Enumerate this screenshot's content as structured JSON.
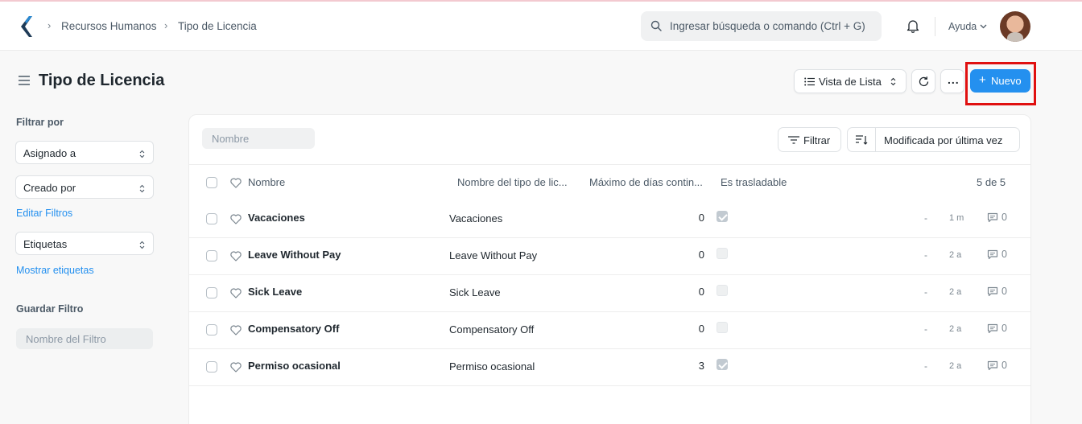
{
  "breadcrumb": [
    "Recursos Humanos",
    "Tipo de Licencia"
  ],
  "search": {
    "placeholder": "Ingresar búsqueda o comando (Ctrl + G)"
  },
  "navbar": {
    "help_label": "Ayuda"
  },
  "page": {
    "title": "Tipo de Licencia",
    "view_button": "Vista de Lista",
    "more_button": "...",
    "new_button": "Nuevo"
  },
  "sidebar": {
    "filter_heading": "Filtrar por",
    "assigned": "Asignado a",
    "created_by": "Creado por",
    "edit_filters": "Editar Filtros",
    "tags": "Etiquetas",
    "show_tags": "Mostrar etiquetas",
    "save_filter_heading": "Guardar Filtro",
    "filter_name_placeholder": "Nombre del Filtro"
  },
  "list": {
    "name_filter_placeholder": "Nombre",
    "filter_button": "Filtrar",
    "sort_label": "Modificada por última vez",
    "columns": [
      "Nombre",
      "Nombre del tipo de lic...",
      "Máximo de días contin...",
      "Es trasladable"
    ],
    "count": "5 de 5",
    "rows": [
      {
        "name": "Vacaciones",
        "type_name": "Vacaciones",
        "max_days": "0",
        "carry_forward": true,
        "dash": "-",
        "modified": "1 m",
        "comments": "0"
      },
      {
        "name": "Leave Without Pay",
        "type_name": "Leave Without Pay",
        "max_days": "0",
        "carry_forward": false,
        "dash": "-",
        "modified": "2 a",
        "comments": "0"
      },
      {
        "name": "Sick Leave",
        "type_name": "Sick Leave",
        "max_days": "0",
        "carry_forward": false,
        "dash": "-",
        "modified": "2 a",
        "comments": "0"
      },
      {
        "name": "Compensatory Off",
        "type_name": "Compensatory Off",
        "max_days": "0",
        "carry_forward": false,
        "dash": "-",
        "modified": "2 a",
        "comments": "0"
      },
      {
        "name": "Permiso ocasional",
        "type_name": "Permiso ocasional",
        "max_days": "3",
        "carry_forward": true,
        "dash": "-",
        "modified": "2 a",
        "comments": "0"
      }
    ]
  },
  "colors": {
    "primary": "#2490ef",
    "highlight": "#e01010",
    "text": "#1f272e",
    "muted": "#7c8790"
  }
}
